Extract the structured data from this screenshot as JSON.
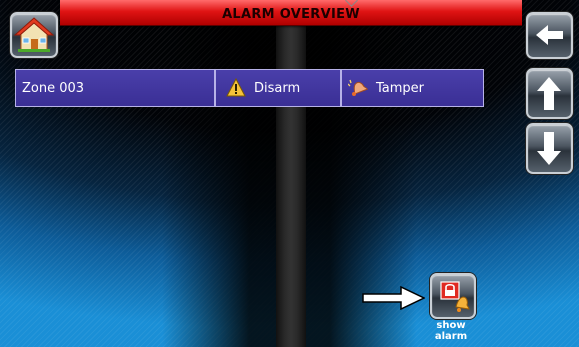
{
  "header": {
    "title": "ALARM OVERVIEW"
  },
  "nav": {
    "home_icon": "home-icon",
    "back_icon": "arrow-left-icon",
    "up_icon": "arrow-up-icon",
    "down_icon": "arrow-down-icon"
  },
  "alarms": [
    {
      "zone": "Zone 003",
      "state": "Disarm",
      "state_icon": "warning-icon",
      "type": "Tamper",
      "type_icon": "bell-icon"
    }
  ],
  "actions": {
    "show_alarm_label": "show\nalarm",
    "show_alarm_icon": "lock-bell-icon"
  },
  "colors": {
    "title_bar": "#e01414",
    "row_background": "#3f349e",
    "row_border": "#b7b2e8",
    "background_glow": "#1a8fd6"
  }
}
